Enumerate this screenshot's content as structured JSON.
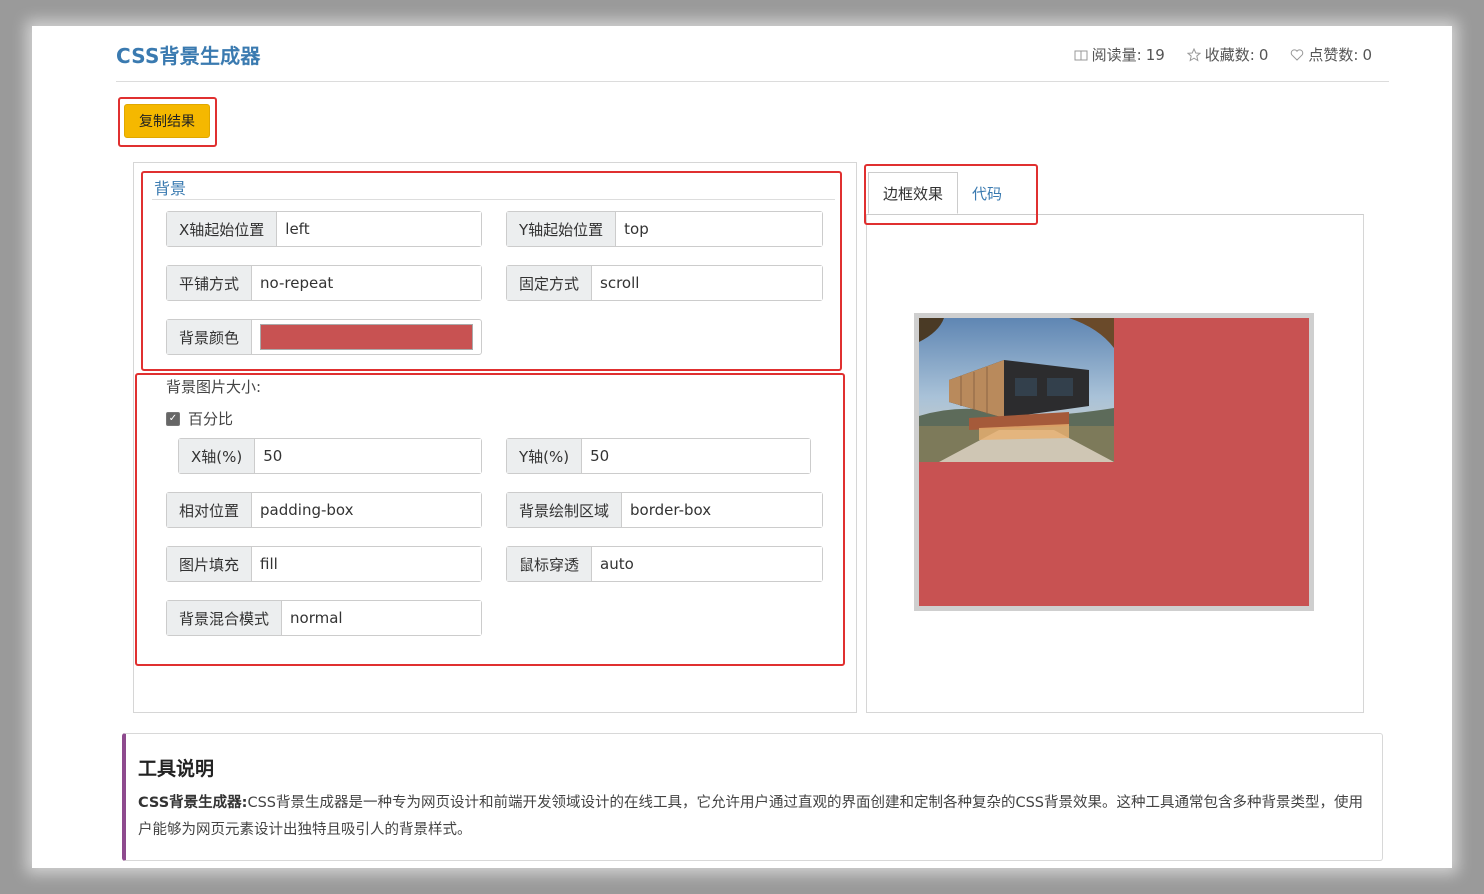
{
  "page": {
    "title": "CSS背景生成器"
  },
  "stats": {
    "read_label": "阅读量:",
    "read_count": "19",
    "fav_label": "收藏数:",
    "fav_count": "0",
    "like_label": "点赞数:",
    "like_count": "0"
  },
  "toolbar": {
    "copy_label": "复制结果"
  },
  "background": {
    "legend": "背景",
    "x_pos_label": "X轴起始位置",
    "x_pos_value": "left",
    "y_pos_label": "Y轴起始位置",
    "y_pos_value": "top",
    "repeat_label": "平铺方式",
    "repeat_value": "no-repeat",
    "attach_label": "固定方式",
    "attach_value": "scroll",
    "color_label": "背景颜色",
    "color_value": "#c85252"
  },
  "size": {
    "label": "背景图片大小:",
    "percent_label": "百分比",
    "percent_checked": true,
    "x_label": "X轴(%)",
    "x_value": "50",
    "y_label": "Y轴(%)",
    "y_value": "50",
    "origin_label": "相对位置",
    "origin_value": "padding-box",
    "clip_label": "背景绘制区域",
    "clip_value": "border-box",
    "fit_label": "图片填充",
    "fit_value": "fill",
    "pointer_label": "鼠标穿透",
    "pointer_value": "auto",
    "blend_label": "背景混合模式",
    "blend_value": "normal"
  },
  "tabs": [
    {
      "label": "边框效果",
      "active": true
    },
    {
      "label": "代码",
      "active": false
    }
  ],
  "description": {
    "heading": "工具说明",
    "bold": "CSS背景生成器:",
    "text": "CSS背景生成器是一种专为网页设计和前端开发领域设计的在线工具，它允许用户通过直观的界面创建和定制各种复杂的CSS背景效果。这种工具通常包含多种背景类型，使用户能够为网页元素设计出独特且吸引人的背景样式。"
  },
  "colors": {
    "accent": "#3a7ab0",
    "button": "#f5b800",
    "highlight": "#e03030",
    "preview_bg": "#c85252"
  }
}
